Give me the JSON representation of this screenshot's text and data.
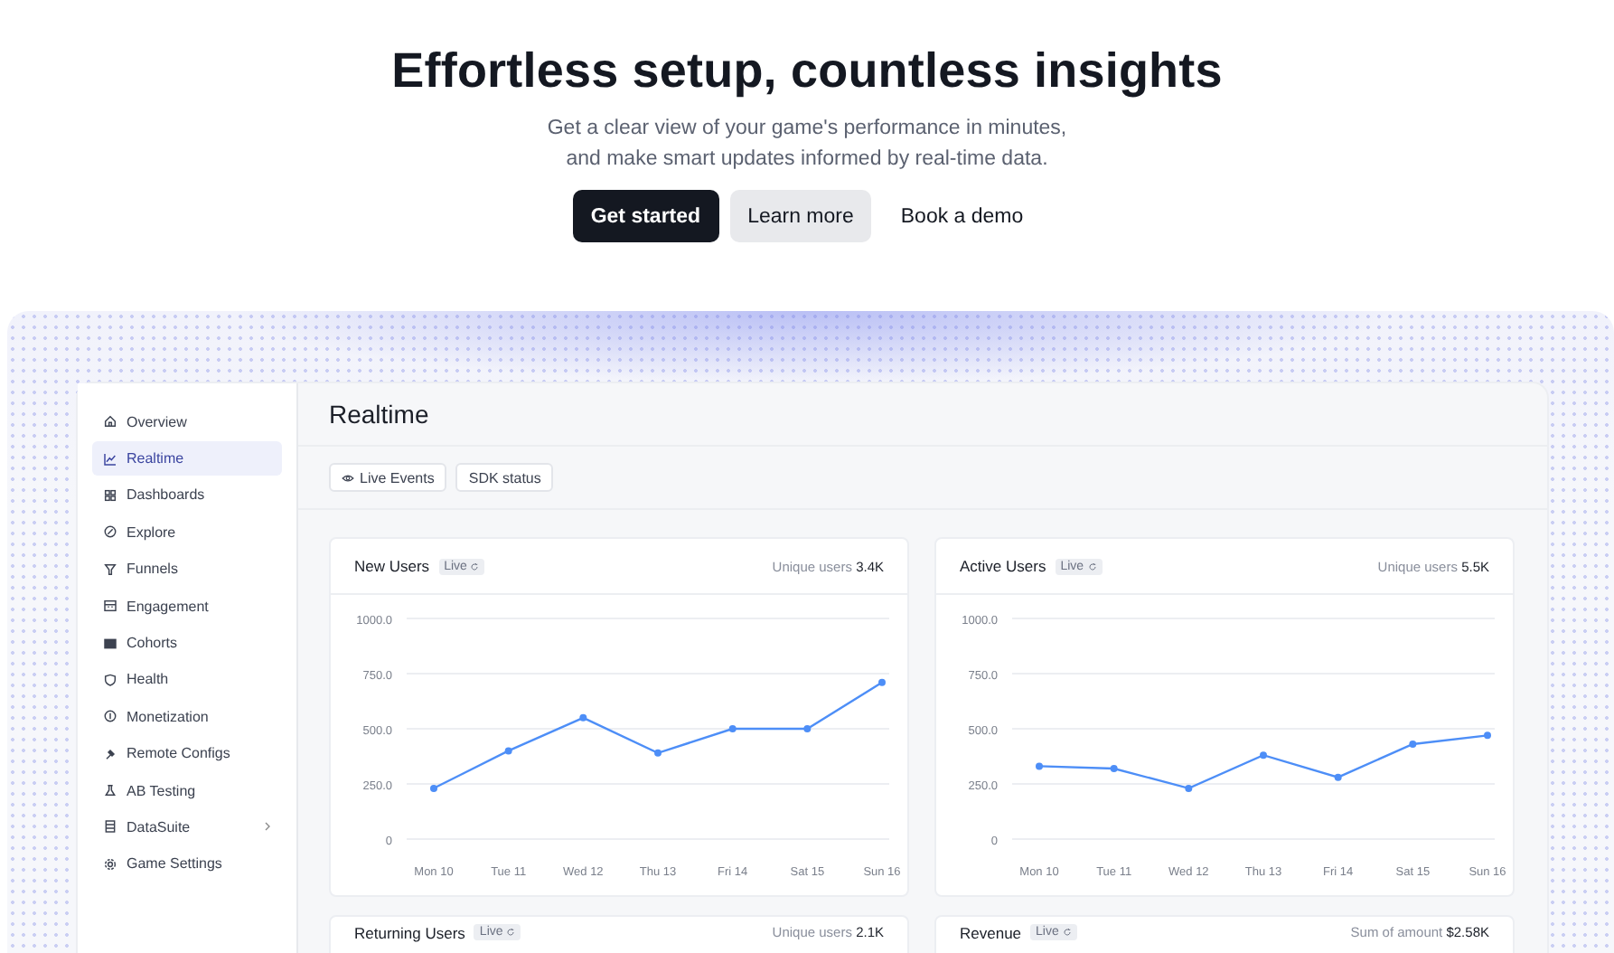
{
  "hero": {
    "title": "Effortless setup, countless insights",
    "subtitle_lines": [
      "Get a clear view of your game's performance in minutes,",
      "and make smart updates informed by real-time data."
    ],
    "buttons": [
      {
        "label": "Get started",
        "kind": "primary"
      },
      {
        "label": "Learn more",
        "kind": "secondary"
      },
      {
        "label": "Book a demo",
        "kind": "plain"
      }
    ]
  },
  "sidebar": {
    "items": [
      {
        "label": "Overview",
        "selected": false
      },
      {
        "label": "Realtime",
        "selected": true
      },
      {
        "label": "Dashboards",
        "selected": false
      },
      {
        "label": "Explore",
        "selected": false
      },
      {
        "label": "Funnels",
        "selected": false
      },
      {
        "label": "Engagement",
        "selected": false
      },
      {
        "label": "Cohorts",
        "selected": false
      },
      {
        "label": "Health",
        "selected": false
      },
      {
        "label": "Monetization",
        "selected": false
      },
      {
        "label": "Remote Configs",
        "selected": false
      },
      {
        "label": "AB Testing",
        "selected": false
      },
      {
        "label": "DataSuite",
        "selected": false,
        "expandable": true
      },
      {
        "label": "Game Settings",
        "selected": false
      }
    ]
  },
  "page": {
    "title": "Realtime",
    "tabs": [
      {
        "label": "Live Events",
        "icon": true
      },
      {
        "label": "SDK status",
        "icon": false
      }
    ]
  },
  "cards": [
    {
      "title": "New Users",
      "badge": "Live",
      "stat_label": "Unique users",
      "stat_value": "3.4K",
      "chart_data": {
        "type": "line",
        "categories": [
          "Mon 10",
          "Tue 11",
          "Wed 12",
          "Thu 13",
          "Fri 14",
          "Sat 15",
          "Sun 16"
        ],
        "ylim": [
          0,
          1000
        ],
        "yticks": [
          {
            "value": 0,
            "label": "0"
          },
          {
            "value": 250,
            "label": "250.0"
          },
          {
            "value": 500,
            "label": "500.0"
          },
          {
            "value": 750,
            "label": "750.0"
          },
          {
            "value": 1000,
            "label": "1000.0"
          }
        ],
        "grid": true,
        "series": [
          {
            "color": "#4d8ef7",
            "marker": "o",
            "values": [
              230,
              400,
              550,
              390,
              500,
              500,
              710
            ]
          }
        ]
      }
    },
    {
      "title": "Active Users",
      "badge": "Live",
      "stat_label": "Unique users",
      "stat_value": "5.5K",
      "chart_data": {
        "type": "line",
        "categories": [
          "Mon 10",
          "Tue 11",
          "Wed 12",
          "Thu 13",
          "Fri 14",
          "Sat 15",
          "Sun 16"
        ],
        "ylim": [
          0,
          1000
        ],
        "yticks": [
          {
            "value": 0,
            "label": "0"
          },
          {
            "value": 250,
            "label": "250.0"
          },
          {
            "value": 500,
            "label": "500.0"
          },
          {
            "value": 750,
            "label": "750.0"
          },
          {
            "value": 1000,
            "label": "1000.0"
          }
        ],
        "grid": true,
        "series": [
          {
            "color": "#4d8ef7",
            "marker": "o",
            "values": [
              330,
              320,
              230,
              380,
              280,
              430,
              470
            ]
          }
        ]
      }
    },
    {
      "title": "Returning Users",
      "badge": "Live",
      "stat_label": "Unique users",
      "stat_value": "2.1K"
    },
    {
      "title": "Revenue",
      "badge": "Live",
      "stat_label": "Sum of amount",
      "stat_value": "$2.58K"
    }
  ]
}
